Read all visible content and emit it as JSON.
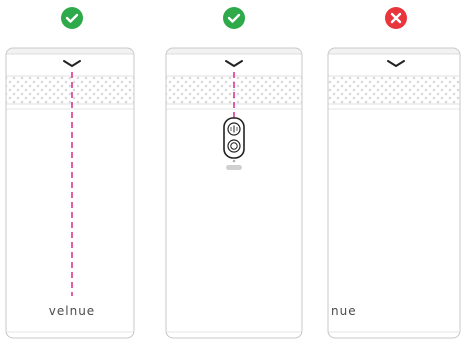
{
  "colors": {
    "check": "#2eaa4b",
    "cross": "#e8363c",
    "guide": "#d61b7f",
    "outline": "#c9c9c9",
    "dots": "#e5e5e5"
  },
  "panels": [
    {
      "status": "correct",
      "status_icon": "check-icon",
      "has_guide": true,
      "has_buttons": false,
      "brand_text": "velnue"
    },
    {
      "status": "correct",
      "status_icon": "check-icon",
      "has_guide": true,
      "has_buttons": true,
      "buttons": [
        {
          "icon": "power-icon"
        },
        {
          "icon": "circle-icon"
        }
      ]
    },
    {
      "status": "incorrect",
      "status_icon": "cross-icon",
      "has_guide": false,
      "has_buttons": false,
      "brand_text": "nue"
    }
  ]
}
